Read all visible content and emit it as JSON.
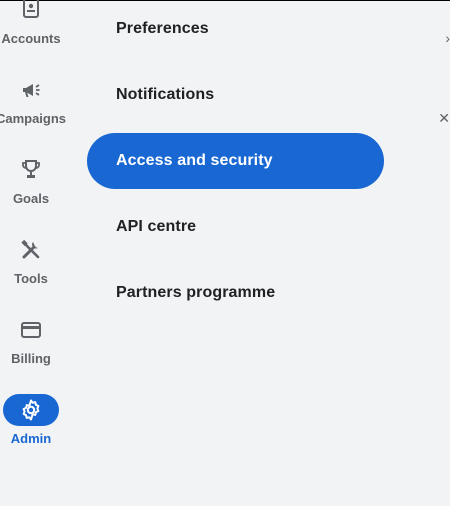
{
  "nav_rail": {
    "items": [
      {
        "label": "Accounts",
        "icon": "accounts-icon"
      },
      {
        "label": "Campaigns",
        "icon": "megaphone-icon"
      },
      {
        "label": "Goals",
        "icon": "trophy-icon"
      },
      {
        "label": "Tools",
        "icon": "tools-icon"
      },
      {
        "label": "Billing",
        "icon": "credit-card-icon"
      },
      {
        "label": "Admin",
        "icon": "gear-icon",
        "active": true
      }
    ]
  },
  "admin_menu": {
    "items": [
      {
        "label": "Preferences"
      },
      {
        "label": "Notifications"
      },
      {
        "label": "Access and security",
        "selected": true
      },
      {
        "label": "API centre"
      },
      {
        "label": "Partners programme"
      }
    ]
  },
  "colors": {
    "accent": "#1967d2",
    "background": "#f1f3f4",
    "rail_text": "#5f6368",
    "menu_text": "#202124"
  }
}
